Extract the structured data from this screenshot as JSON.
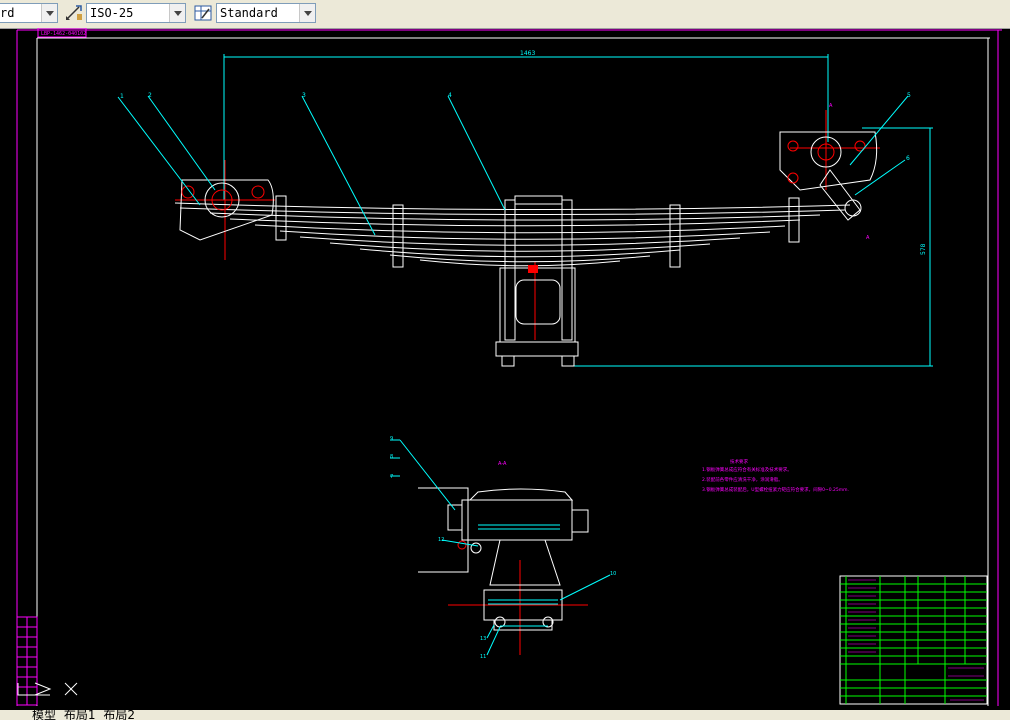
{
  "toolbar": {
    "textstyle_value": "rd",
    "dimstyle_value": "ISO-25",
    "tablestyle_value": "Standard"
  },
  "icons": {
    "dimstyle": "dimension-style-icon",
    "tablestyle": "table-style-icon",
    "ucs": "ucs-icon"
  },
  "drawing": {
    "title_tag": "LBP-1462-040102",
    "dim_width": "1463",
    "dim_height": "578",
    "section_marker": "A",
    "section_title": "A-A",
    "part_numbers": [
      "1",
      "2",
      "3",
      "4",
      "5",
      "6"
    ],
    "section_part_numbers": [
      "9",
      "8",
      "7",
      "12",
      "11",
      "10",
      "13"
    ],
    "notes": [
      "技术要求",
      "1.钢板弹簧总成应符合有关标准及技术要求。",
      "2.装配前各零件应清洗干净，涂润滑脂。",
      "3.钢板弹簧总成装配后，U型螺栓扭紧力矩应符合要求，间隙0~0.25mm."
    ]
  },
  "tabs": [
    "模型",
    "布局1",
    "布局2"
  ],
  "colors": {
    "outline": "#ffffff",
    "leader": "#00ffff",
    "border": "#ff00ff",
    "centerline": "#ff0000",
    "titleblock": "#00ff00"
  }
}
